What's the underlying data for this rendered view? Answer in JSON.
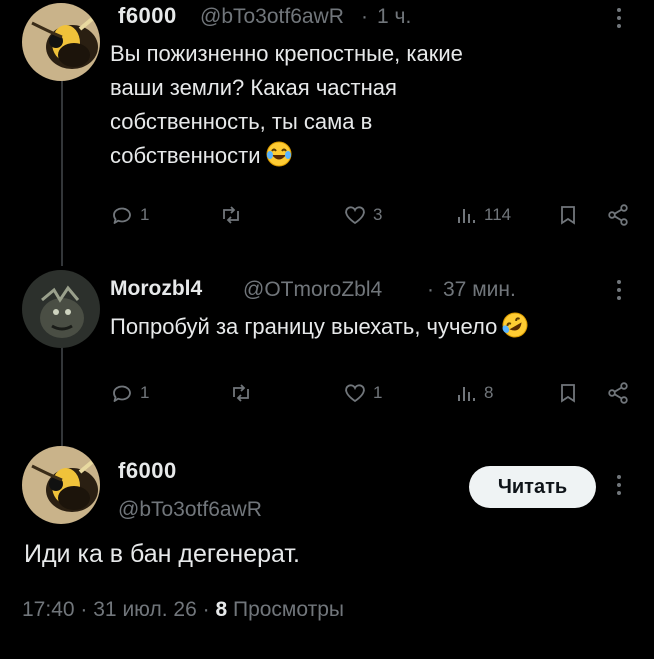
{
  "tweet1": {
    "display_name": "f6000",
    "handle": "@bTo3otf6awR",
    "separator": "·",
    "time": "1 ч.",
    "text_lines": [
      "Вы пожизненно крепостные, какие",
      "ваши земли? Какая частная",
      "собственность, ты сама в",
      "собственности"
    ],
    "emoji": "tears-of-joy-emoji",
    "replies": "1",
    "retweets": "",
    "likes": "3",
    "views": "114"
  },
  "tweet2": {
    "display_name": "Morozbl4",
    "handle": "@OTmoroZbl4",
    "separator": "·",
    "time": "37 мин.",
    "text": "Попробуй за границу выехать, чучело",
    "emoji": "rolling-laughing-emoji",
    "replies": "1",
    "retweets": "",
    "likes": "1",
    "views": "8"
  },
  "main_tweet": {
    "display_name": "f6000",
    "handle": "@bTo3otf6awR",
    "follow_label": "Читать",
    "text": "Иди ка в бан дегенерат.",
    "time": "17:40",
    "dot1": "·",
    "date": "31 июл. 26",
    "dot2": "·",
    "views_count": "8",
    "views_label": "Просмотры"
  },
  "colors": {
    "background": "#000000",
    "text": "#e7e9ea",
    "muted": "#71767b",
    "button_bg": "#eff3f4"
  }
}
